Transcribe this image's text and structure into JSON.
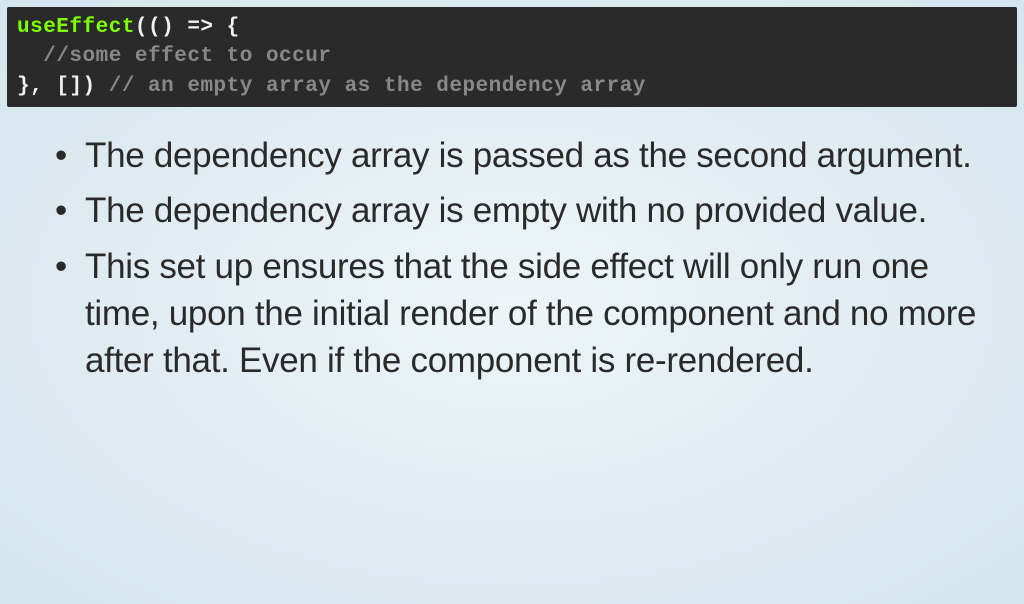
{
  "code": {
    "line1": {
      "keyword": "useEffect",
      "rest": "(() => {"
    },
    "line2": {
      "indent": "  ",
      "comment": "//some effect to occur"
    },
    "line3": {
      "closing": "}, [])",
      "comment": " // an empty array as the dependency array"
    }
  },
  "bullets": [
    "The dependency array is passed as the second argument.",
    "The dependency array is empty with no provided value.",
    "This set up ensures that the side effect will only run one time, upon the initial render of the component and no more after that. Even if the component is re-rendered."
  ]
}
